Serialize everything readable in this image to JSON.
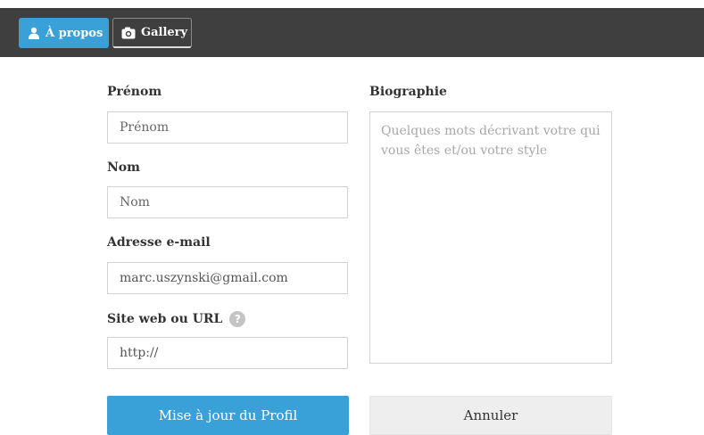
{
  "tabs": {
    "about": {
      "label": "À propos",
      "icon": "user-icon"
    },
    "gallery": {
      "label": "Gallery",
      "icon": "camera-icon"
    }
  },
  "form": {
    "first_name": {
      "label": "Prénom",
      "placeholder": "Prénom",
      "value": ""
    },
    "last_name": {
      "label": "Nom",
      "placeholder": "Nom",
      "value": ""
    },
    "email": {
      "label": "Adresse e-mail",
      "value": "marc.uszynski@gmail.com"
    },
    "website": {
      "label": "Site web ou URL",
      "value": "http://",
      "help": "?"
    },
    "bio": {
      "label": "Biographie",
      "placeholder": "Quelques mots décrivant votre qui vous êtes et/ou votre style",
      "value": ""
    }
  },
  "buttons": {
    "update": "Mise à jour du Profil",
    "cancel": "Annuler"
  },
  "colors": {
    "topbar": "#3f3f3f",
    "accent": "#3aa0d8",
    "cancel_bg": "#eeeeee",
    "border": "#d3d3d3"
  }
}
